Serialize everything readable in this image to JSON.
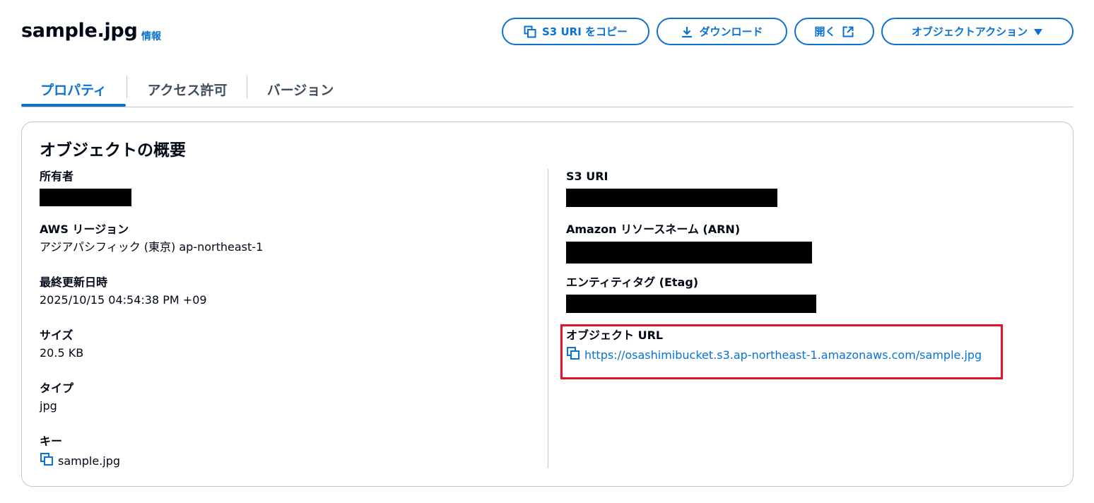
{
  "header": {
    "title": "sample.jpg",
    "info": "情報",
    "buttons": {
      "copy_uri": "S3 URI をコピー",
      "download": "ダウンロード",
      "open": "開く",
      "actions": "オブジェクトアクション"
    }
  },
  "tabs": [
    {
      "label": "プロパティ",
      "active": true
    },
    {
      "label": "アクセス許可",
      "active": false
    },
    {
      "label": "バージョン",
      "active": false
    }
  ],
  "overview": {
    "title": "オブジェクトの概要",
    "left": {
      "owner": {
        "label": "所有者",
        "value_redacted": true
      },
      "region": {
        "label": "AWS リージョン",
        "value": "アジアパシフィック (東京) ap-northeast-1"
      },
      "last_modified": {
        "label": "最終更新日時",
        "value": "2025/10/15 04:54:38 PM +09"
      },
      "size": {
        "label": "サイズ",
        "value": "20.5 KB"
      },
      "type": {
        "label": "タイプ",
        "value": "jpg"
      },
      "key": {
        "label": "キー",
        "value": "sample.jpg"
      }
    },
    "right": {
      "s3_uri": {
        "label": "S3 URI",
        "value_redacted": true
      },
      "arn": {
        "label": "Amazon リソースネーム (ARN)",
        "value_redacted": true
      },
      "etag": {
        "label": "エンティティタグ (Etag)",
        "value_redacted": true
      },
      "object_url": {
        "label": "オブジェクト URL",
        "value": "https://osashimibucket.s3.ap-northeast-1.amazonaws.com/sample.jpg"
      }
    }
  },
  "icons": {
    "copy": "copy-icon",
    "download": "download-icon",
    "external": "external-link-icon",
    "caret": "caret-down-icon"
  },
  "colors": {
    "accent": "#0972d3",
    "text": "#000716",
    "border": "#c6c6cd",
    "highlight": "#e3132a"
  }
}
